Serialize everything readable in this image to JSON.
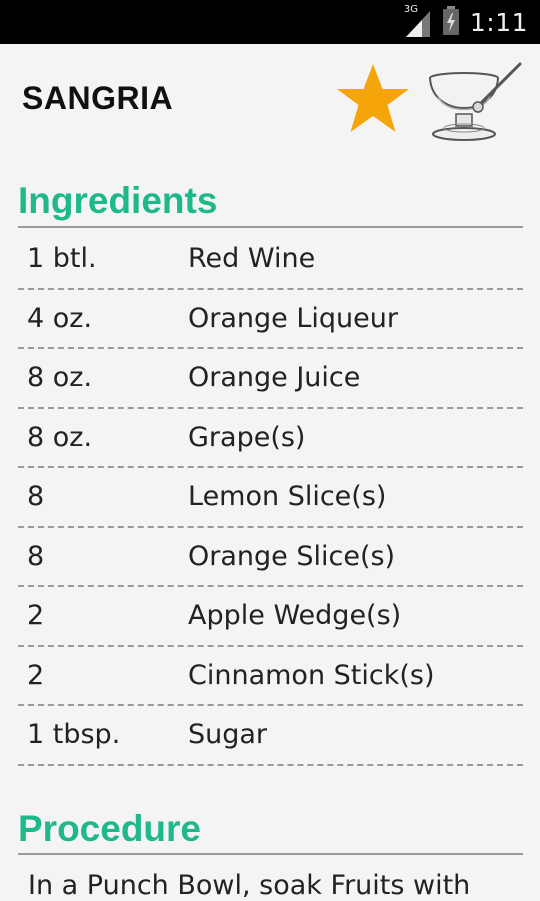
{
  "status_bar": {
    "network": "3G",
    "time": "1:11",
    "icons": [
      "signal-icon",
      "battery-icon"
    ]
  },
  "recipe": {
    "title": "SANGRIA",
    "favorite_icon": "star-icon",
    "glass_icon": "punch-bowl-icon"
  },
  "ingredients": {
    "heading": "Ingredients",
    "items": [
      {
        "qty": "1 btl.",
        "name": "Red Wine"
      },
      {
        "qty": "4 oz.",
        "name": "Orange Liqueur"
      },
      {
        "qty": "8 oz.",
        "name": "Orange Juice"
      },
      {
        "qty": "8 oz.",
        "name": "Grape(s)"
      },
      {
        "qty": "8",
        "name": "Lemon Slice(s)"
      },
      {
        "qty": "8",
        "name": "Orange Slice(s)"
      },
      {
        "qty": "2",
        "name": "Apple Wedge(s)"
      },
      {
        "qty": "2",
        "name": "Cinnamon Stick(s)"
      },
      {
        "qty": "1 tbsp.",
        "name": "Sugar"
      }
    ]
  },
  "procedure": {
    "heading": "Procedure",
    "text": "In a Punch Bowl, soak Fruits with"
  },
  "colors": {
    "accent": "#1fb88a",
    "star": "#f5a50a",
    "status_bar": "#000000"
  }
}
